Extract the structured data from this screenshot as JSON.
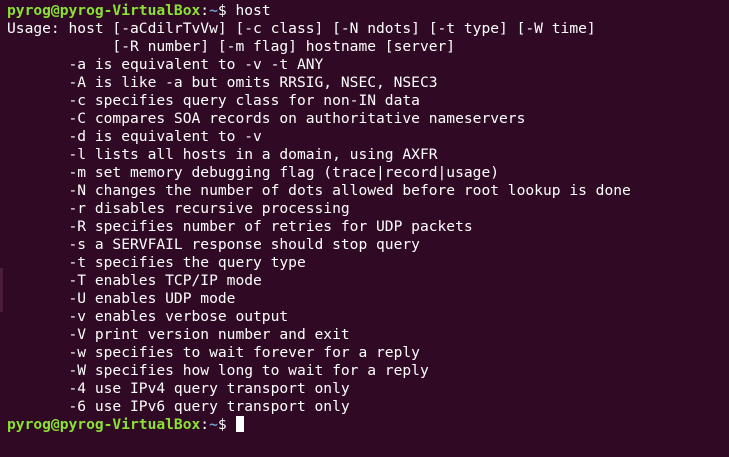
{
  "colors": {
    "background": "#300a24",
    "text": "#ffffff",
    "prompt_user": "#8ae234",
    "prompt_path": "#729fcf"
  },
  "prompt": {
    "user_host": "pyrog@pyrog-VirtualBox",
    "separator": ":",
    "path": "~",
    "symbol": "$ "
  },
  "command": "host",
  "output": [
    "Usage: host [-aCdilrTvVw] [-c class] [-N ndots] [-t type] [-W time]",
    "            [-R number] [-m flag] hostname [server]",
    "       -a is equivalent to -v -t ANY",
    "       -A is like -a but omits RRSIG, NSEC, NSEC3",
    "       -c specifies query class for non-IN data",
    "       -C compares SOA records on authoritative nameservers",
    "       -d is equivalent to -v",
    "       -l lists all hosts in a domain, using AXFR",
    "       -m set memory debugging flag (trace|record|usage)",
    "       -N changes the number of dots allowed before root lookup is done",
    "       -r disables recursive processing",
    "       -R specifies number of retries for UDP packets",
    "       -s a SERVFAIL response should stop query",
    "       -t specifies the query type",
    "       -T enables TCP/IP mode",
    "       -U enables UDP mode",
    "       -v enables verbose output",
    "       -V print version number and exit",
    "       -w specifies to wait forever for a reply",
    "       -W specifies how long to wait for a reply",
    "       -4 use IPv4 query transport only",
    "       -6 use IPv6 query transport only"
  ]
}
